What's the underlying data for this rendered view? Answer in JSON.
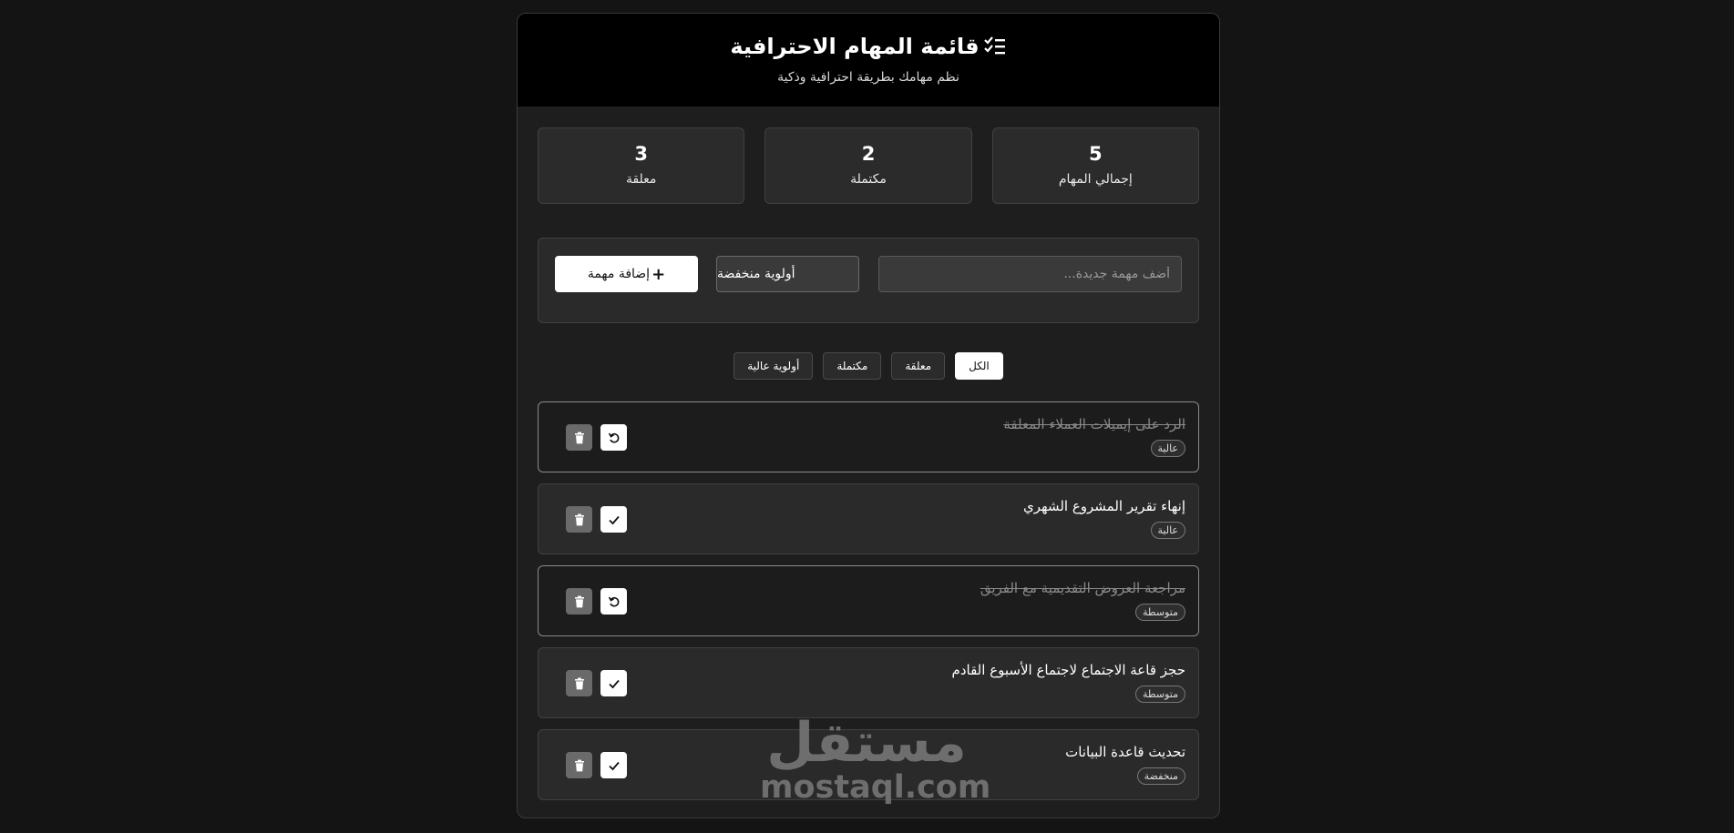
{
  "header": {
    "title": "قائمة المهام الاحترافية",
    "subtitle": "نظم مهامك بطريقة احترافية وذكية",
    "icon": "checklist-icon"
  },
  "stats": [
    {
      "value": "5",
      "label": "إجمالي المهام"
    },
    {
      "value": "2",
      "label": "مكتملة"
    },
    {
      "value": "3",
      "label": "معلقة"
    }
  ],
  "add_form": {
    "placeholder": "أضف مهمة جديدة...",
    "priority_selected": "أولوية منخفضة",
    "add_label": "إضافة مهمة"
  },
  "filters": [
    {
      "label": "الكل",
      "active": true
    },
    {
      "label": "معلقة",
      "active": false
    },
    {
      "label": "مكتملة",
      "active": false
    },
    {
      "label": "أولوية عالية",
      "active": false
    }
  ],
  "tasks": [
    {
      "text": "الرد على إيميلات العملاء المعلقة",
      "priority": "عالية",
      "completed": true
    },
    {
      "text": "إنهاء تقرير المشروع الشهري",
      "priority": "عالية",
      "completed": false
    },
    {
      "text": "مراجعة العروض التقديمية مع الفريق",
      "priority": "متوسطة",
      "completed": true
    },
    {
      "text": "حجز قاعة الاجتماع لاجتماع الأسبوع القادم",
      "priority": "متوسطة",
      "completed": false
    },
    {
      "text": "تحديث قاعدة البيانات",
      "priority": "منخفضة",
      "completed": false
    }
  ],
  "watermark": {
    "arabic": "مستقل",
    "latin": "mostaql.com"
  },
  "colors": {
    "background": "#141414",
    "card": "#1e1e1e",
    "header": "#000000",
    "accent": "#ffffff"
  }
}
